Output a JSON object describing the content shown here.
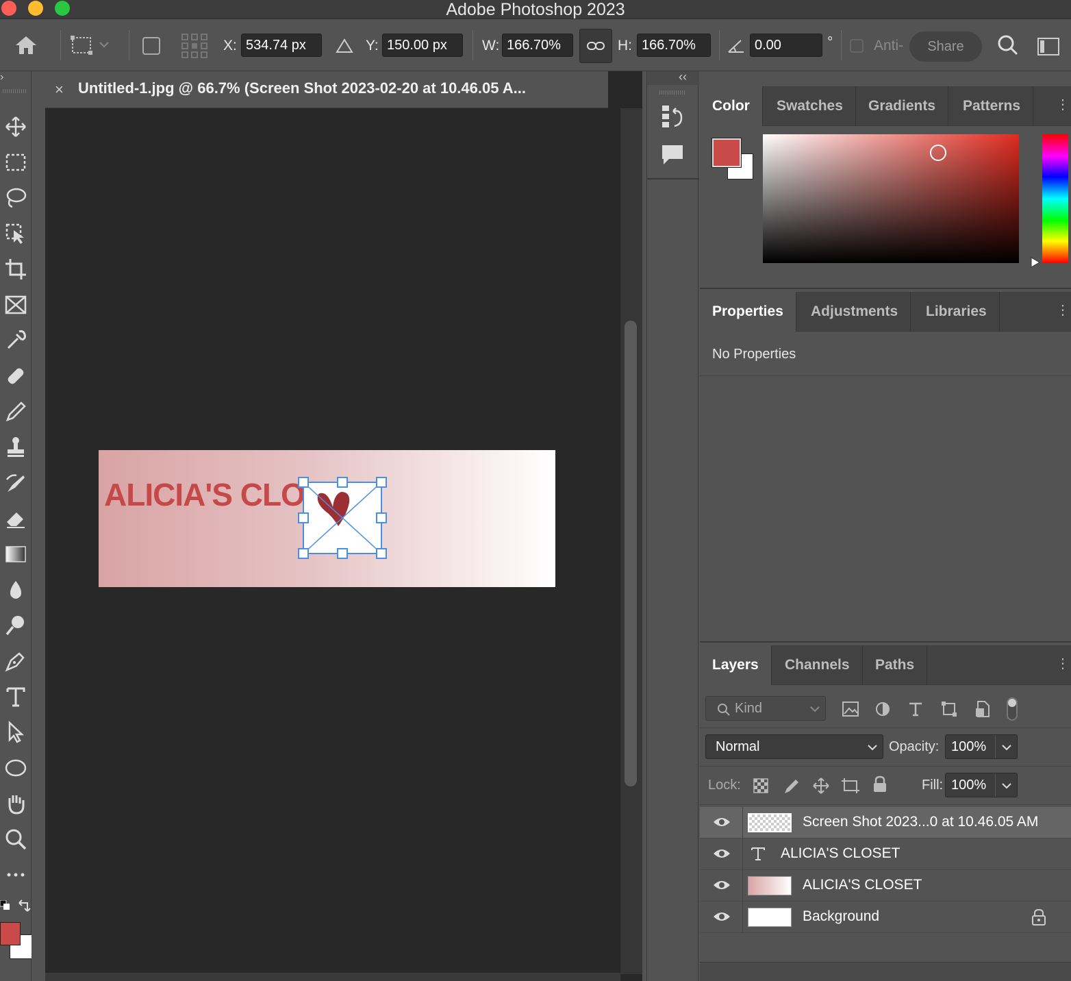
{
  "app": {
    "title": "Adobe Photoshop 2023",
    "traffic_colors": [
      "#ff5f57",
      "#febc2e",
      "#28c840"
    ]
  },
  "options_bar": {
    "x_label": "X:",
    "x_value": "534.74 px",
    "y_label": "Y:",
    "y_value": "150.00 px",
    "w_label": "W:",
    "w_value": "166.70%",
    "h_label": "H:",
    "h_value": "166.70%",
    "angle_value": "0.00",
    "degree_symbol": "°",
    "anti_alias_label": "Anti-",
    "share_label": "Share"
  },
  "document": {
    "tab_title": "Untitled-1.jpg @ 66.7% (Screen Shot 2023-02-20 at 10.46.05 A...",
    "close_glyph": "×",
    "canvas_text": "ALICIA'S CLO",
    "accent_color": "#c6494a"
  },
  "color_panel": {
    "tabs": [
      "Color",
      "Swatches",
      "Gradients",
      "Patterns"
    ],
    "foreground_color": "#c94a48",
    "background_color": "#ffffff"
  },
  "properties_panel": {
    "tabs": [
      "Properties",
      "Adjustments",
      "Libraries"
    ],
    "message": "No Properties"
  },
  "layers_panel": {
    "tabs": [
      "Layers",
      "Channels",
      "Paths"
    ],
    "filter_placeholder": "Kind",
    "blend_mode": "Normal",
    "opacity_label": "Opacity:",
    "opacity_value": "100%",
    "lock_label": "Lock:",
    "fill_label": "Fill:",
    "fill_value": "100%",
    "layers": [
      {
        "name": "Screen Shot 2023...0 at 10.46.05 AM",
        "kind": "smart-object",
        "selected": true
      },
      {
        "name": "ALICIA'S CLOSET",
        "kind": "text",
        "selected": false
      },
      {
        "name": "ALICIA'S CLOSET",
        "kind": "gradient",
        "selected": false
      },
      {
        "name": "Background",
        "kind": "background",
        "selected": false,
        "locked": true
      }
    ]
  }
}
